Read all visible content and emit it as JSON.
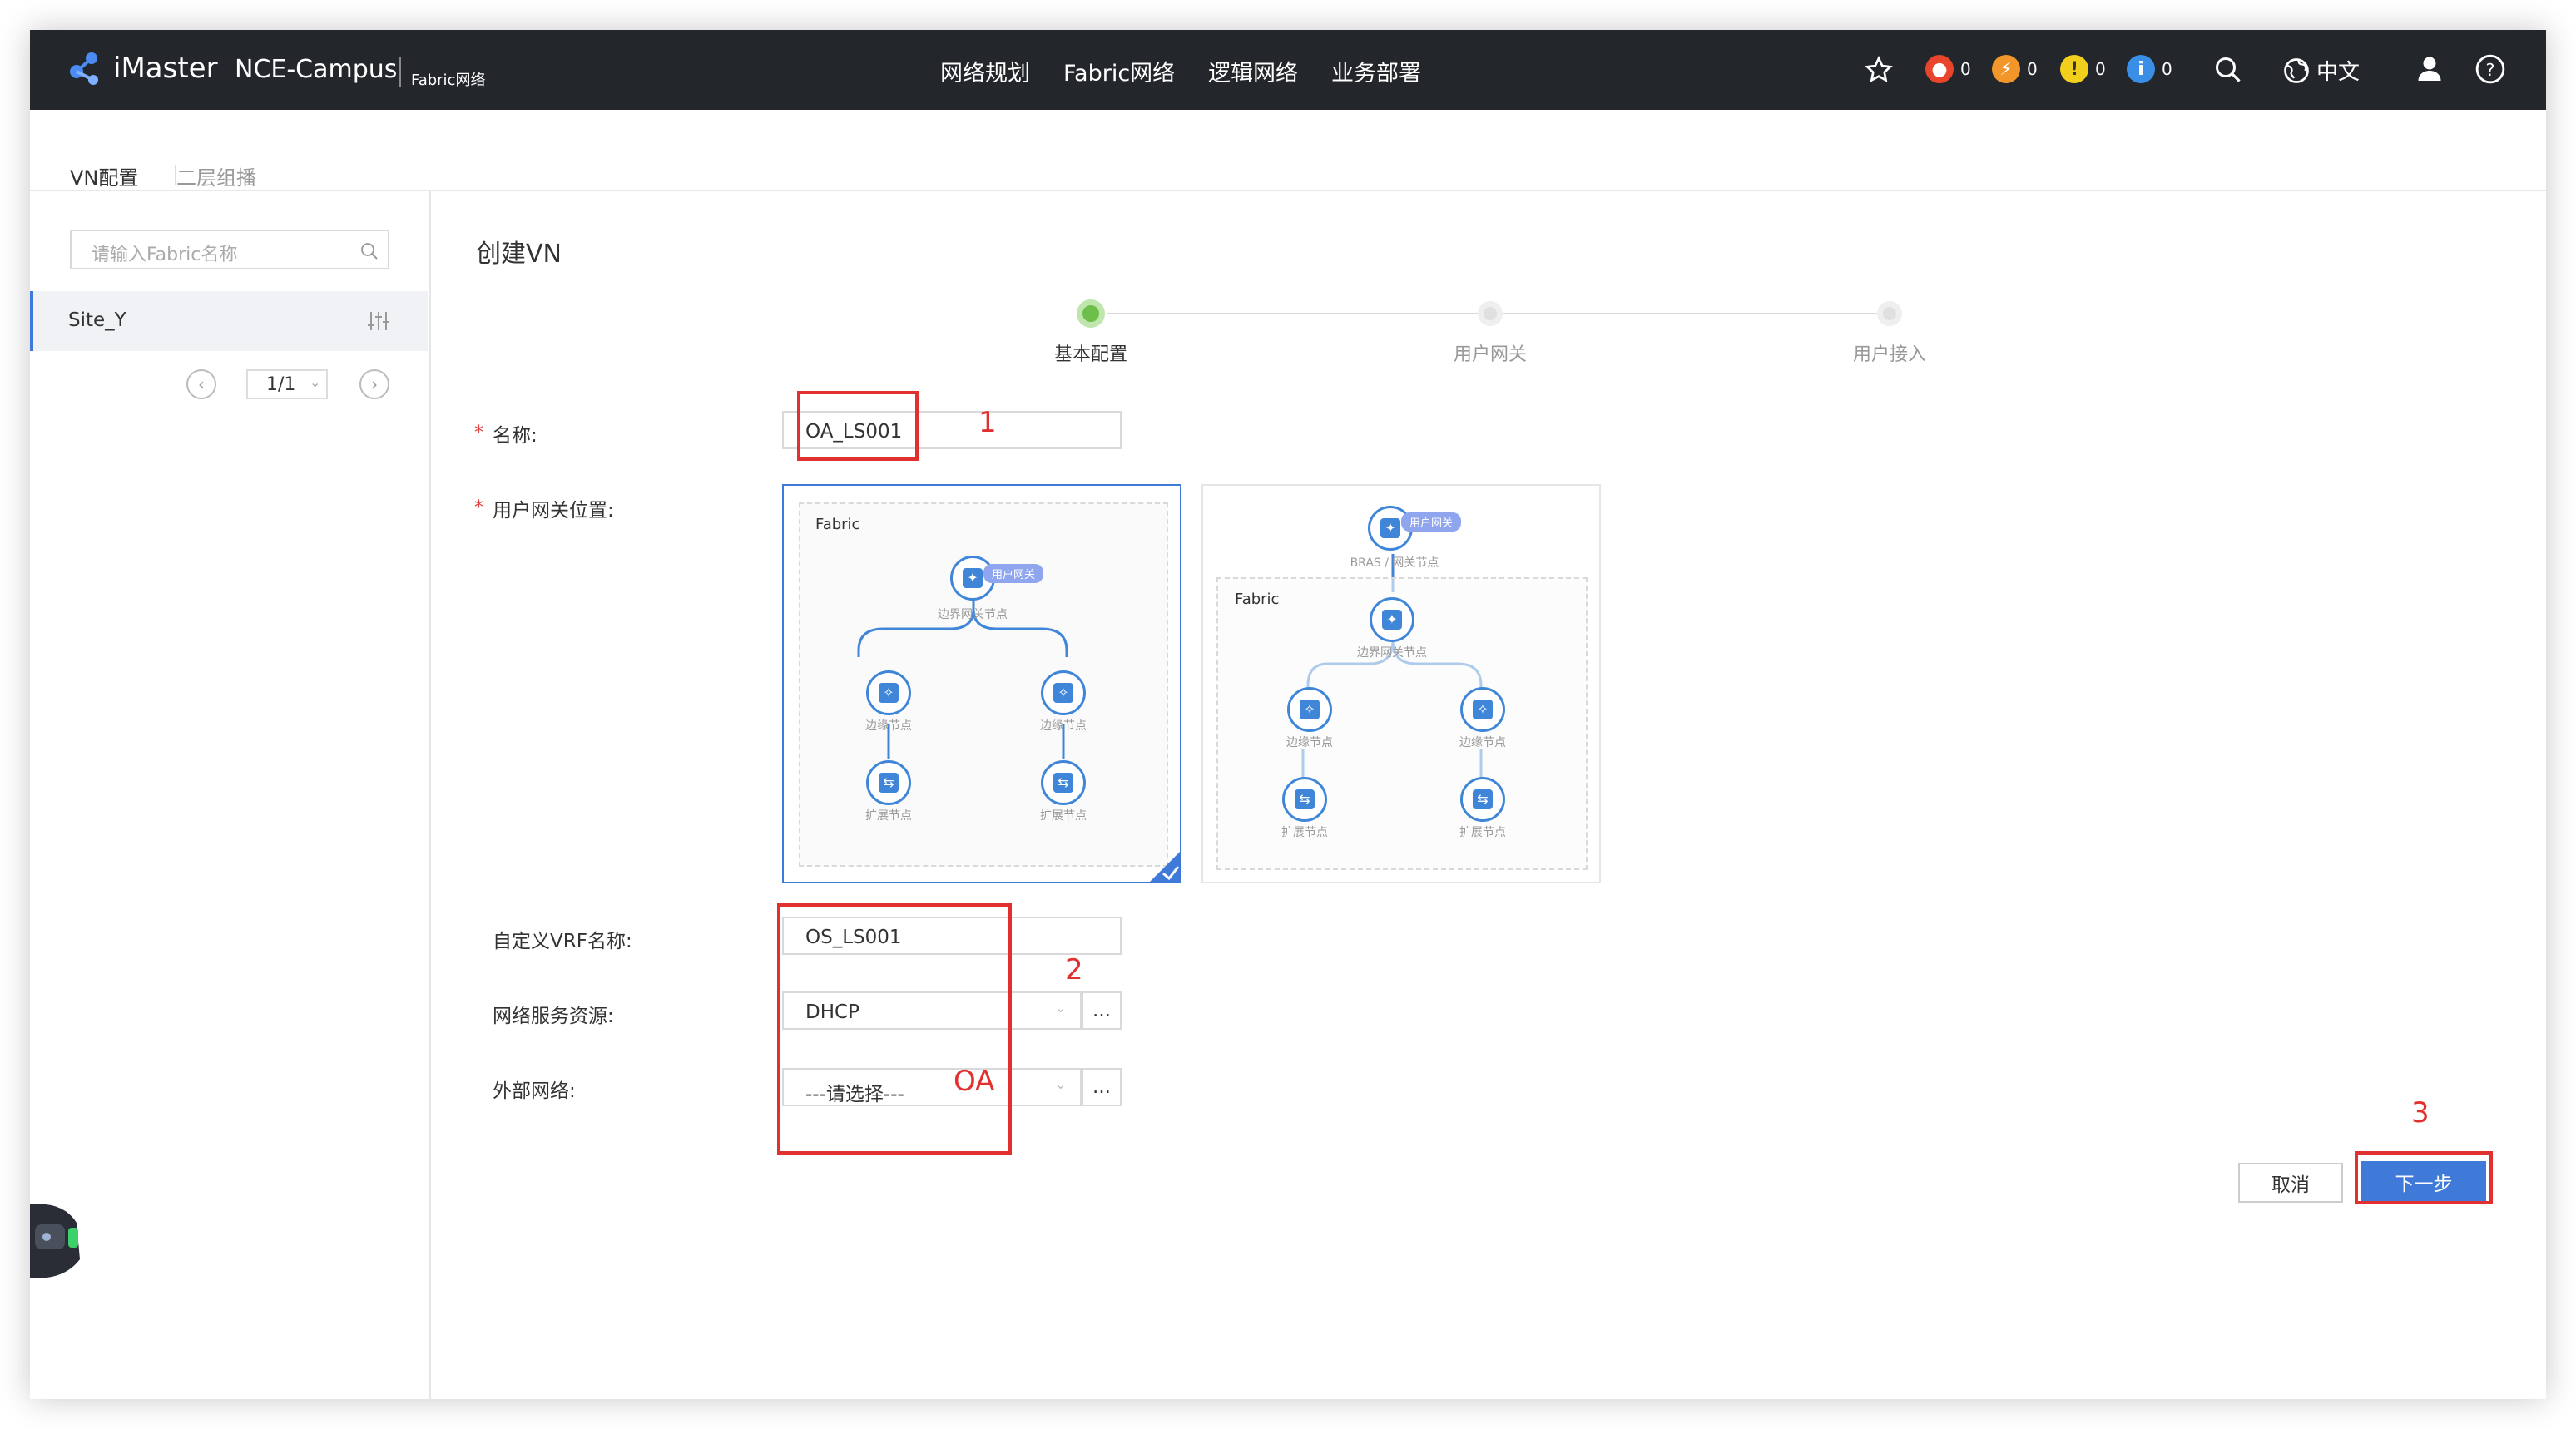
{
  "topbar": {
    "brand": "iMaster",
    "product": "NCE-Campus",
    "subtitle": "Fabric网络",
    "nav": [
      "网络规划",
      "Fabric网络",
      "逻辑网络",
      "业务部署"
    ],
    "alarms": [
      {
        "icon": "critical-alarm-icon",
        "count": "0",
        "color": "#e8452c"
      },
      {
        "icon": "major-alarm-icon",
        "count": "0",
        "color": "#f0962a"
      },
      {
        "icon": "minor-alarm-icon",
        "count": "0",
        "color": "#f3cf1d"
      },
      {
        "icon": "info-alarm-icon",
        "count": "0",
        "color": "#3a8ee6"
      }
    ],
    "language": "中文"
  },
  "tabs": [
    {
      "label": "VN配置",
      "active": true
    },
    {
      "label": "二层组播",
      "active": false
    }
  ],
  "sidebar": {
    "search_placeholder": "请输入Fabric名称",
    "items": [
      {
        "label": "Site_Y"
      }
    ],
    "pager": "1/1"
  },
  "main": {
    "title": "创建VN",
    "steps": [
      {
        "label": "基本配置",
        "state": "active"
      },
      {
        "label": "用户网关",
        "state": "pending"
      },
      {
        "label": "用户接入",
        "state": "pending"
      }
    ],
    "form": {
      "name_label": "名称:",
      "name_value": "OA_LS001",
      "gateway_label": "用户网关位置:",
      "vrf_label": "自定义VRF名称:",
      "vrf_value": "OS_LS001",
      "service_label": "网络服务资源:",
      "service_value": "DHCP",
      "external_label": "外部网络:",
      "external_value": "---请选择---",
      "more": "..."
    },
    "diagram_left": {
      "fabric": "Fabric",
      "tag": "用户网关",
      "border": "边界网关节点",
      "edge": "边缘节点",
      "ext": "扩展节点"
    },
    "diagram_right": {
      "fabric": "Fabric",
      "tag": "用户网关",
      "bras": "BRAS / 网关节点",
      "border": "边界网关节点",
      "edge": "边缘节点",
      "ext": "扩展节点"
    },
    "cancel": "取消",
    "next": "下一步"
  },
  "annotations": {
    "a1": "1",
    "a2": "2",
    "a3": "3",
    "oa": "OA"
  },
  "colors": {
    "topbar": "#23262a",
    "accent": "#3f7ad8",
    "success": "#6cbf4a",
    "annotation": "#e03030"
  }
}
